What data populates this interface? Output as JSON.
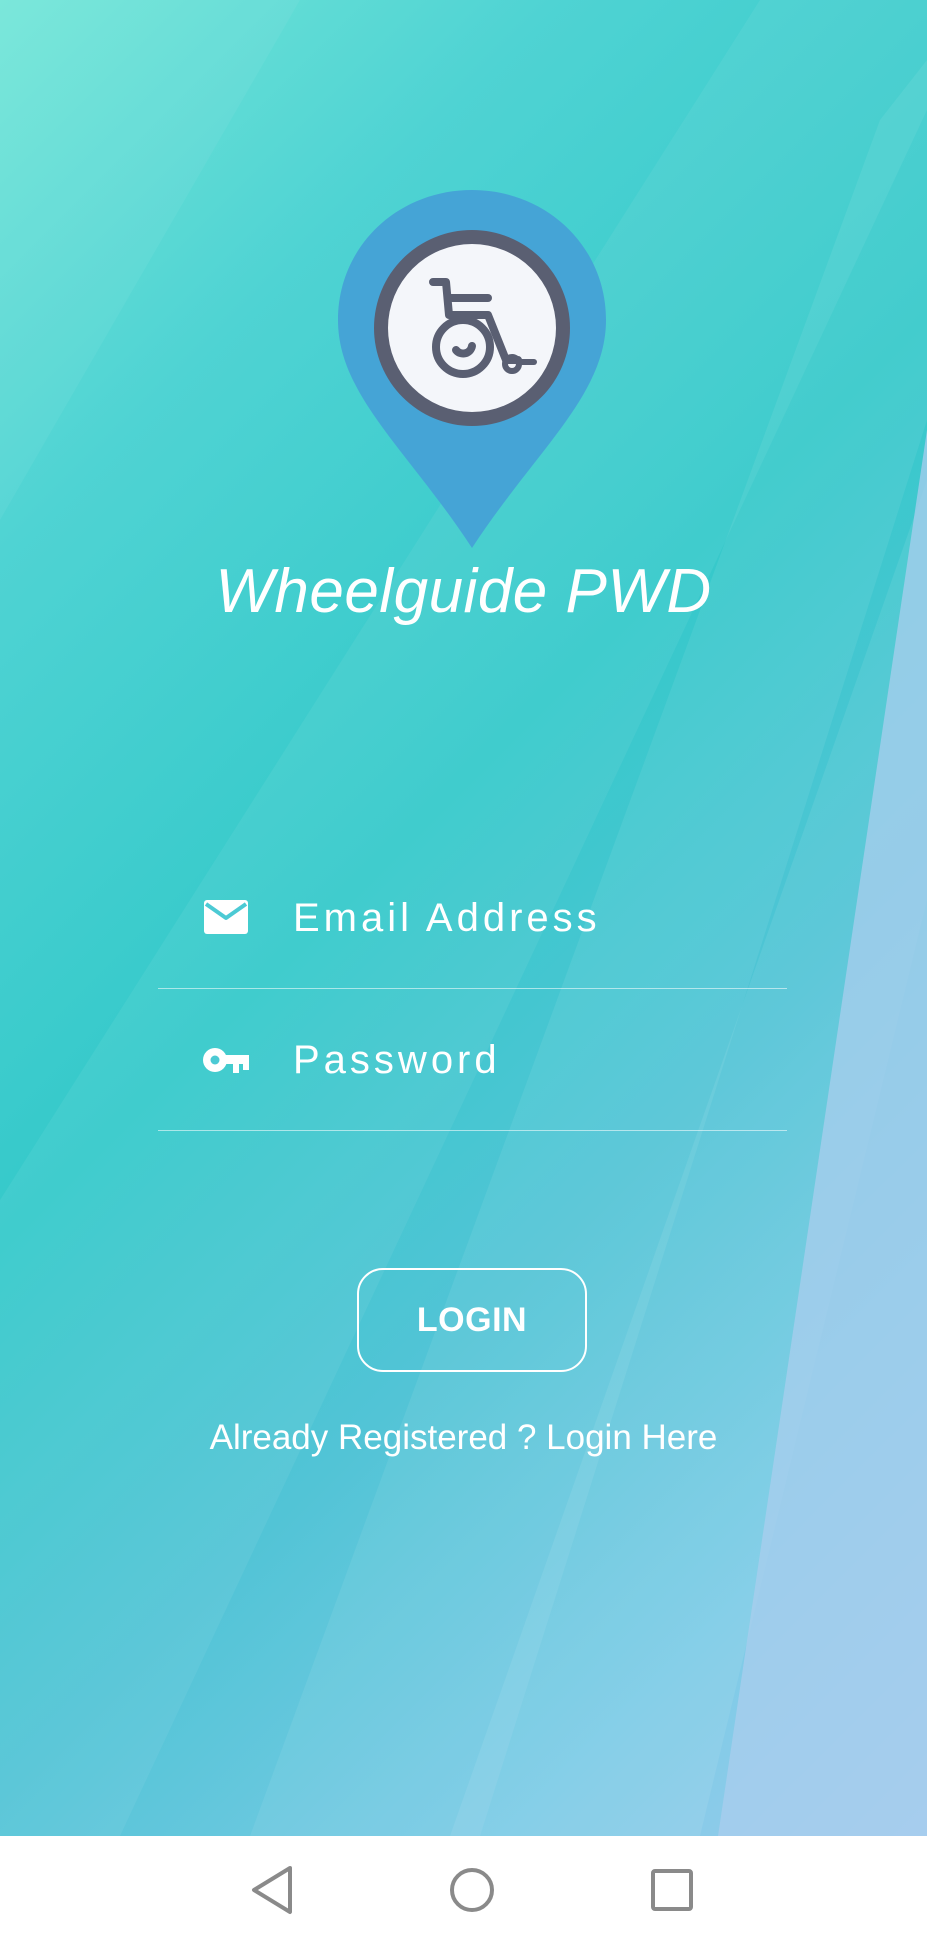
{
  "app": {
    "title": "Wheelguide PWD",
    "logo_icon": "wheelchair-location-pin-icon"
  },
  "form": {
    "email": {
      "icon": "envelope-icon",
      "placeholder": "Email Address",
      "value": ""
    },
    "password": {
      "icon": "key-icon",
      "placeholder": "Password",
      "value": ""
    },
    "login_label": "LOGIN",
    "register_link": "Already Registered ? Login Here"
  },
  "navigation": {
    "back_icon": "triangle-back-icon",
    "home_icon": "circle-home-icon",
    "recent_icon": "square-recents-icon"
  },
  "colors": {
    "pin_blue": "#45a4d6",
    "logo_ring": "#5a5f72",
    "logo_fill": "#f4f6fa",
    "text": "#ffffff",
    "nav_icon": "#8a8a8a"
  }
}
